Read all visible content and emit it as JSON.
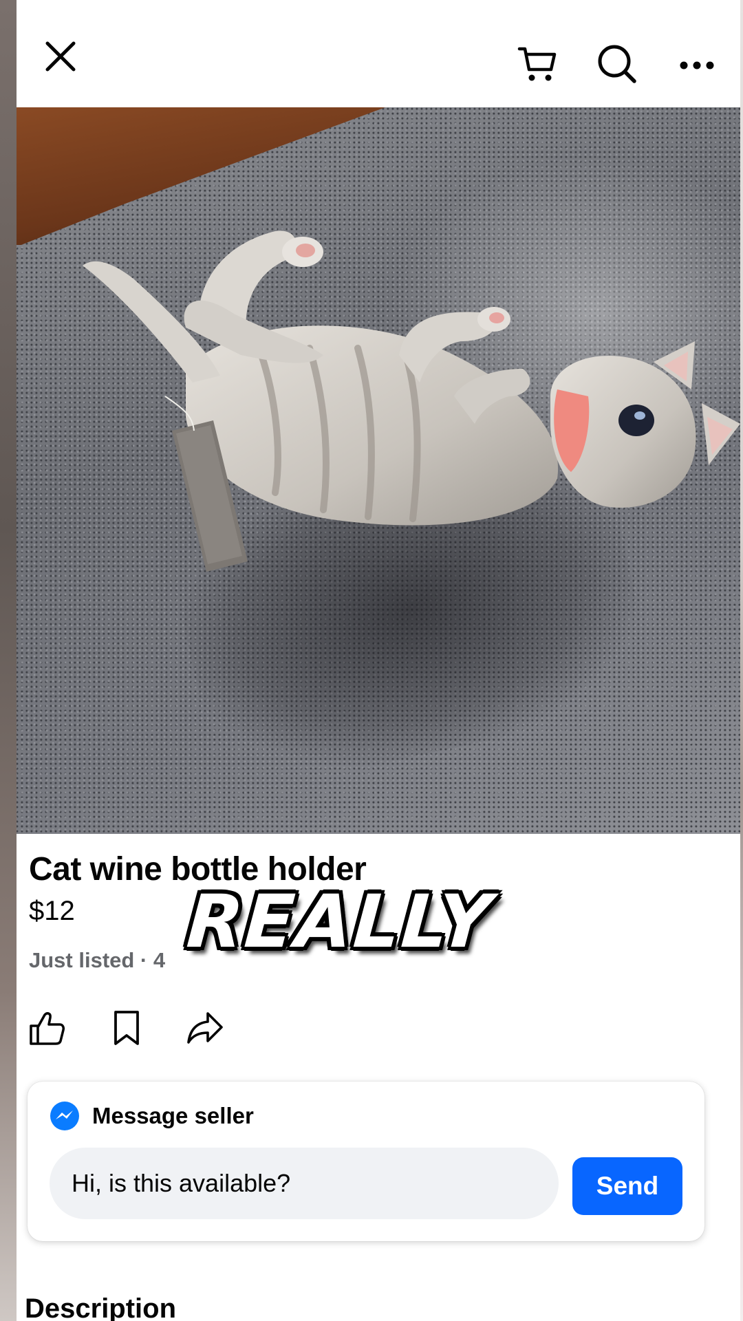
{
  "header": {
    "icons": [
      "close-icon",
      "cart-icon",
      "search-icon",
      "more-icon"
    ]
  },
  "photo": {
    "subject": "cat-figurine-photo",
    "slide_count": 4,
    "active_slide": 1
  },
  "listing": {
    "title": "Cat wine bottle holder",
    "price": "$12",
    "listed": "Just listed · 4"
  },
  "overlay_caption": "REALLY",
  "actions": {
    "icons": [
      "like-icon",
      "save-icon",
      "share-icon"
    ]
  },
  "message": {
    "heading": "Message seller",
    "input_value": "Hi, is this available?",
    "send_label": "Send"
  },
  "description": {
    "heading": "Description"
  },
  "colors": {
    "accent": "#0866ff",
    "secondary_text": "#65676b",
    "input_bg": "#f0f2f5"
  }
}
